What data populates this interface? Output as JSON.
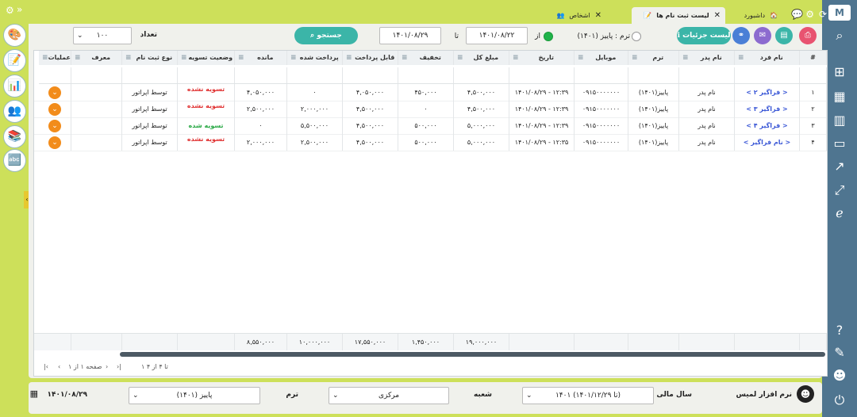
{
  "tabs": [
    {
      "label": "داشبورد"
    },
    {
      "label": "لیست ثبت نام ها"
    },
    {
      "label": "اشخاص"
    }
  ],
  "toolbar": {
    "details_label": "لیست جزئیات",
    "term_radio_label": "ترم : پاییز (۱۴۰۱)",
    "from_label": "از",
    "from_date": "۱۴۰۱/۰۸/۲۲",
    "to_label": "تا",
    "to_date": "۱۴۰۱/۰۸/۲۹",
    "search_label": "جستجو",
    "count_label": "تعداد",
    "count_value": "۱۰۰"
  },
  "columns": [
    "#",
    "نام فرد",
    "نام پدر",
    "ترم",
    "موبایل",
    "تاریخ",
    "مبلغ کل",
    "تخفیف",
    "قابل پرداخت",
    "پرداخت شده",
    "مانده",
    "وضعیت تسویه",
    "نوع ثبت نام",
    "معرف",
    "عملیات"
  ],
  "rows": [
    {
      "num": "۱",
      "name": "< فراگیر ۲ >",
      "father": "نام پدر",
      "term": "پاییز(۱۴۰۱)",
      "mobile": "۰۹۱۵۰۰۰۰۰۰۰",
      "date": "۱۴۰۱/۰۸/۲۹ - ۱۲:۳۹",
      "total": "۴,۵۰۰,۰۰۰",
      "discount": "۴۵۰,۰۰۰",
      "payable": "۴,۰۵۰,۰۰۰",
      "paid": "۰",
      "remain": "۴,۰۵۰,۰۰۰",
      "status": "تسویه نشده",
      "regtype": "توسط اپراتور",
      "ref": ""
    },
    {
      "num": "۲",
      "name": "< فراگیر ۳ >",
      "father": "نام پدر",
      "term": "پاییز(۱۴۰۱)",
      "mobile": "۰۹۱۵۰۰۰۰۰۰۰",
      "date": "۱۴۰۱/۰۸/۲۹ - ۱۲:۳۹",
      "total": "۴,۵۰۰,۰۰۰",
      "discount": "۰",
      "payable": "۴,۵۰۰,۰۰۰",
      "paid": "۲,۰۰۰,۰۰۰",
      "remain": "۲,۵۰۰,۰۰۰",
      "status": "تسویه نشده",
      "regtype": "توسط اپراتور",
      "ref": ""
    },
    {
      "num": "۳",
      "name": "< فراگیر ۴ >",
      "father": "نام پدر",
      "term": "پاییز(۱۴۰۱)",
      "mobile": "۰۹۱۵۰۰۰۰۰۰۰",
      "date": "۱۴۰۱/۰۸/۲۹ - ۱۲:۳۹",
      "total": "۵,۰۰۰,۰۰۰",
      "discount": "۵۰۰,۰۰۰",
      "payable": "۴,۵۰۰,۰۰۰",
      "paid": "۵,۵۰۰,۰۰۰",
      "remain": "۰",
      "status": "تسویه شده",
      "regtype": "توسط اپراتور",
      "ref": ""
    },
    {
      "num": "۴",
      "name": "< نام فراگیر >",
      "father": "نام پدر",
      "term": "پاییز(۱۴۰۱)",
      "mobile": "۰۹۱۵۰۰۰۰۰۰۰",
      "date": "۱۴۰۱/۰۸/۲۹ - ۱۲:۳۵",
      "total": "۵,۰۰۰,۰۰۰",
      "discount": "۵۰۰,۰۰۰",
      "payable": "۴,۵۰۰,۰۰۰",
      "paid": "۲,۵۰۰,۰۰۰",
      "remain": "۲,۰۰۰,۰۰۰",
      "status": "تسویه نشده",
      "regtype": "توسط اپراتور",
      "ref": ""
    }
  ],
  "totals": {
    "total": "۱۹,۰۰۰,۰۰۰",
    "discount": "۱,۴۵۰,۰۰۰",
    "payable": "۱۷,۵۵۰,۰۰۰",
    "paid": "۱۰,۰۰۰,۰۰۰",
    "remain": "۸,۵۵۰,۰۰۰"
  },
  "pagination": {
    "range": "۱ تا ۴ از ۴",
    "page": "صفحه ۱ از ۱"
  },
  "footer": {
    "username": "نرم افزار لمیس",
    "fiscal_label": "سال مالی",
    "fiscal_value": "۱۴۰۱ (۱۴۰۱/۱۲/۲۹ تا)",
    "branch_label": "شعبه",
    "branch_value": "مرکزی",
    "term_label": "ترم",
    "term_value": "پاییز (۱۴۰۱)",
    "date": "۱۴۰۱/۰۸/۲۹"
  }
}
